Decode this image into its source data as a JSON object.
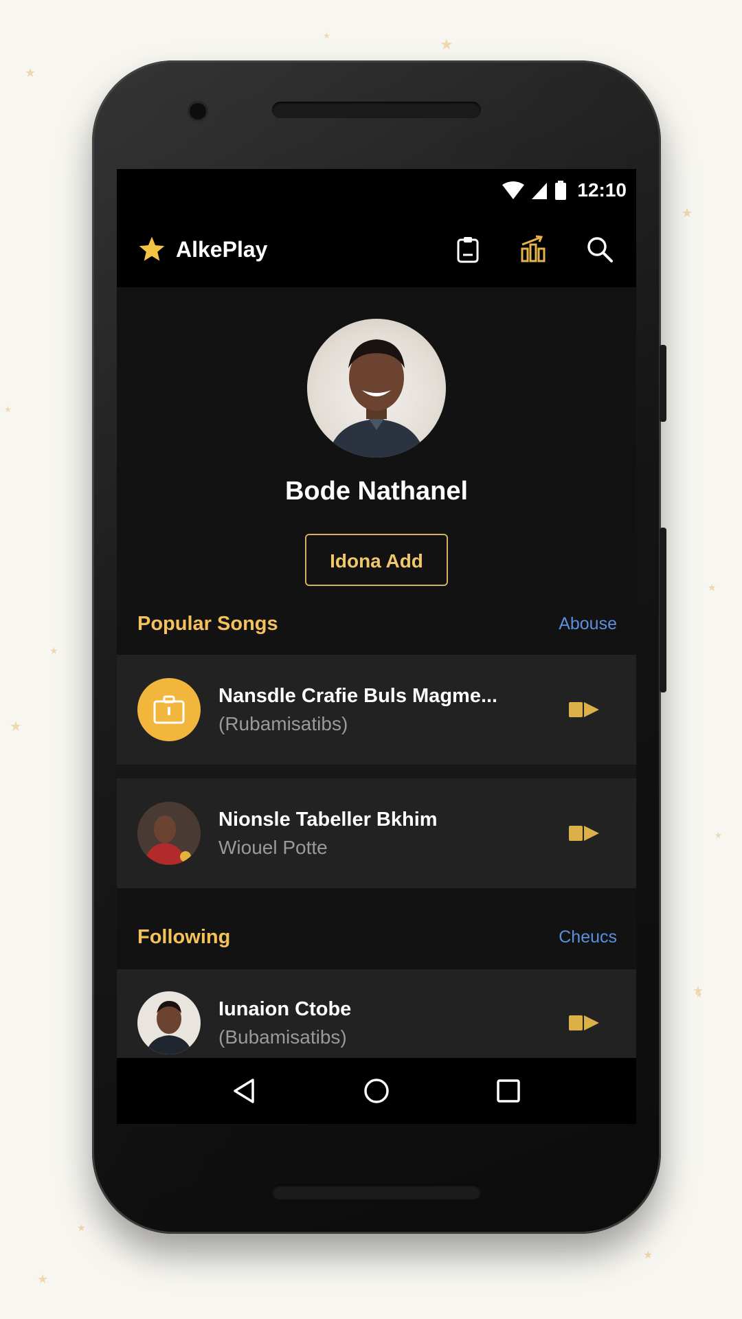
{
  "status": {
    "time": "12:10"
  },
  "app": {
    "title": "AlkePlay"
  },
  "profile": {
    "name": "Bode Nathanel",
    "add_button": "Idona Add"
  },
  "popular": {
    "title": "Popular Songs",
    "link": "Abouse",
    "items": [
      {
        "title": "Nansdle Crafie Buls Magme...",
        "subtitle": "(Rubamisatibs)"
      },
      {
        "title": "Nionsle Tabeller Bkhim",
        "subtitle": "Wiouel Potte"
      }
    ]
  },
  "following": {
    "title": "Following",
    "link": "Cheucs",
    "items": [
      {
        "title": "Iunaion Ctobe",
        "subtitle": "(Bubamisatibs)"
      }
    ]
  },
  "colors": {
    "accent": "#f5c15a",
    "link": "#5b8fe0",
    "background": "#121212"
  },
  "icons": [
    "star-logo-icon",
    "clipboard-icon",
    "chart-icon",
    "search-icon",
    "play-icon",
    "back-icon",
    "home-icon",
    "recents-icon"
  ]
}
